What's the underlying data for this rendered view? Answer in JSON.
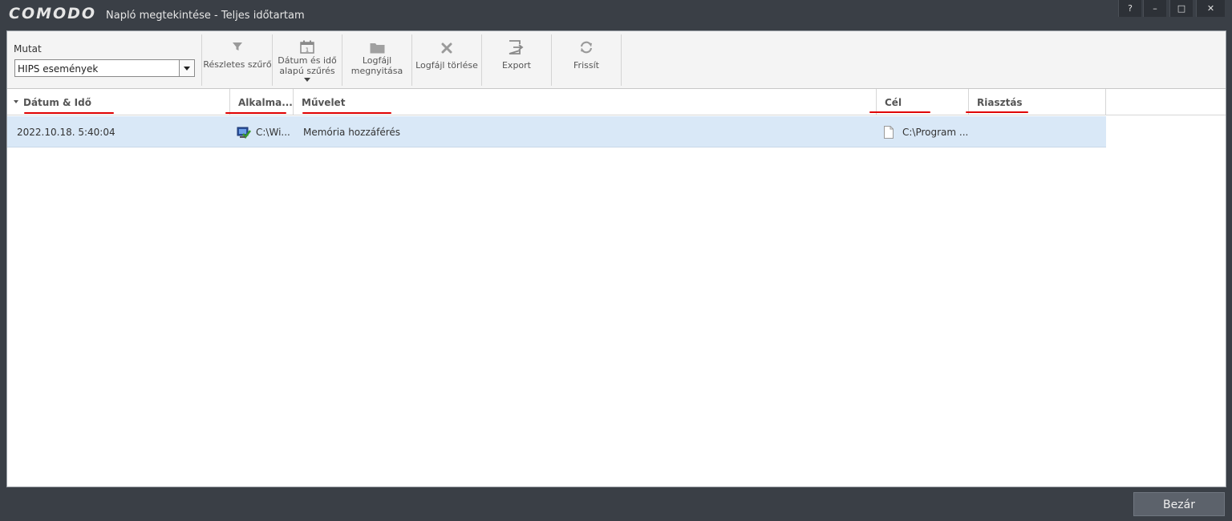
{
  "window": {
    "brand": "COMODO",
    "title": "Napló megtekintése - Teljes időtartam",
    "controls": {
      "help": "?",
      "minimize": "–",
      "maximize": "□",
      "close": "✕"
    }
  },
  "toolbar": {
    "show_label": "Mutat",
    "show_select_value": "HIPS események",
    "buttons": [
      {
        "label": "Részletes szűrő",
        "icon": "filter-icon"
      },
      {
        "label_line1": "Dátum és idő",
        "label_line2": "alapú szűrés",
        "icon": "calendar-icon",
        "calendar_day": "1"
      },
      {
        "label_line1": "Logfájl",
        "label_line2": "megnyitása",
        "icon": "folder-icon"
      },
      {
        "label": "Logfájl törlése",
        "icon": "delete-icon"
      },
      {
        "label": "Export",
        "icon": "export-icon"
      },
      {
        "label": "Frissít",
        "icon": "refresh-icon"
      }
    ]
  },
  "table": {
    "columns": [
      "Dátum & Idő",
      "Alkalma...",
      "Művelet",
      "Cél",
      "Riasztás"
    ],
    "rows": [
      {
        "datetime": "2022.10.18. 5:40:04",
        "application": "C:\\Wi...",
        "action": "Memória hozzáférés",
        "target": "C:\\Program ...",
        "alert": ""
      }
    ]
  },
  "footer": {
    "close_label": "Bezár"
  },
  "colors": {
    "selected_row": "#d9e8f7",
    "annotation": "#e00000",
    "chrome": "#3a3f46"
  }
}
